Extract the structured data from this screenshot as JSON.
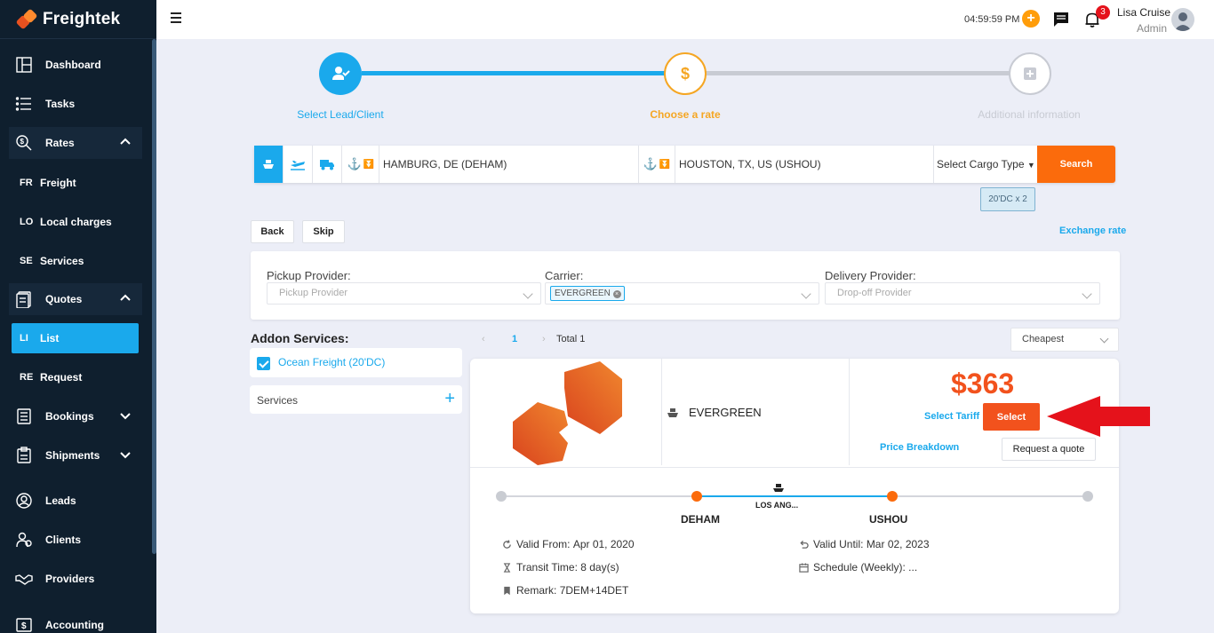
{
  "app": {
    "name": "Freightek"
  },
  "sidebar": {
    "items": [
      {
        "label": "Dashboard"
      },
      {
        "label": "Tasks"
      },
      {
        "label": "Rates"
      },
      {
        "abbr": "FR",
        "label": "Freight"
      },
      {
        "abbr": "LO",
        "label": "Local charges"
      },
      {
        "abbr": "SE",
        "label": "Services"
      },
      {
        "label": "Quotes"
      },
      {
        "abbr": "LI",
        "label": "List"
      },
      {
        "abbr": "RE",
        "label": "Request"
      },
      {
        "label": "Bookings"
      },
      {
        "label": "Shipments"
      },
      {
        "label": "Leads"
      },
      {
        "label": "Clients"
      },
      {
        "label": "Providers"
      },
      {
        "label": "Accounting"
      }
    ]
  },
  "topbar": {
    "clock": "04:59:59 PM",
    "notifications_count": "3",
    "user_name": "Lisa Cruise",
    "user_role": "Admin"
  },
  "stepper": {
    "steps": [
      {
        "label": "Select Lead/Client"
      },
      {
        "label": "Choose a rate"
      },
      {
        "label": "Additional information"
      }
    ]
  },
  "search": {
    "origin": "HAMBURG, DE (DEHAM)",
    "destination": "HOUSTON, TX, US (USHOU)",
    "cargo_type_placeholder": "Select Cargo Type",
    "search_label": "Search",
    "cargo_tag": "20'DC x 2"
  },
  "actions": {
    "back_label": "Back",
    "skip_label": "Skip",
    "exchange_rate_label": "Exchange rate"
  },
  "filters": {
    "pickup_label": "Pickup Provider:",
    "pickup_placeholder": "Pickup Provider",
    "carrier_label": "Carrier:",
    "carrier_value": "EVERGREEN",
    "delivery_label": "Delivery Provider:",
    "delivery_placeholder": "Drop-off Provider"
  },
  "addons": {
    "title": "Addon Services:",
    "ocean_freight": "Ocean Freight (20'DC)",
    "services_label": "Services"
  },
  "pagination": {
    "current_page": "1",
    "total": "Total 1",
    "sort_value": "Cheapest"
  },
  "result": {
    "carrier": "EVERGREEN",
    "price": "$363",
    "select_tariff_label": "Select Tariff",
    "select_label": "Select",
    "price_breakdown_label": "Price Breakdown",
    "request_quote_label": "Request a quote",
    "origin_port": "DEHAM",
    "transit_port": "LOS ANG...",
    "destination_port": "USHOU",
    "valid_from_label": "Valid From:",
    "valid_from": "Apr 01, 2020",
    "valid_until_label": "Valid Until:",
    "valid_until": "Mar 02, 2023",
    "transit_time_label": "Transit Time:",
    "transit_time": "8 day(s)",
    "schedule_label": "Schedule (Weekly):",
    "schedule": "...",
    "remark_label": "Remark:",
    "remark": "7DEM+14DET"
  },
  "colors": {
    "accent_blue": "#1aa9ec",
    "brand_orange": "#fb6b0c",
    "price_red": "#f2521d",
    "step_pending": "#f5a623",
    "sidebar_bg": "#0f1f2e",
    "annotation_arrow": "#e5121b"
  }
}
